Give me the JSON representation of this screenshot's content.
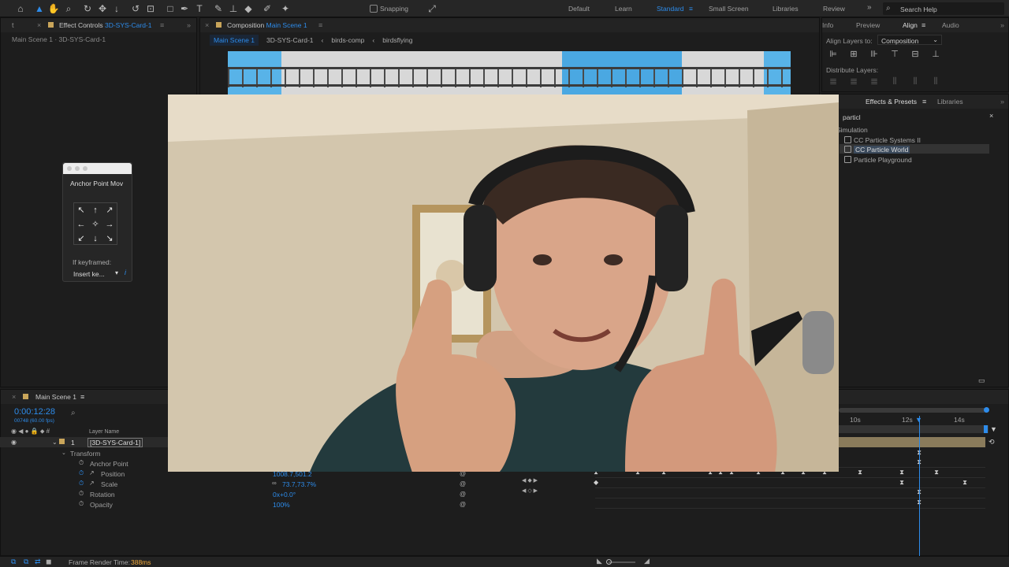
{
  "toolbar": {
    "snapping_label": "Snapping",
    "workspaces": [
      "Default",
      "Learn",
      "Standard",
      "Small Screen",
      "Libraries",
      "Review"
    ],
    "search_placeholder": "Search Help"
  },
  "effect_controls": {
    "tab_prefix": "Effect Controls",
    "tab_layer": "3D-SYS-Card-1",
    "subtitle": "Main Scene 1 · 3D-SYS-Card-1"
  },
  "composition": {
    "tab_prefix": "Composition",
    "tab_name": "Main Scene 1",
    "breadcrumbs": [
      "Main Scene 1",
      "3D-SYS-Card-1",
      "birds-comp",
      "birdsflying"
    ]
  },
  "anchor_window": {
    "title": "Anchor Point Mov",
    "if_keyframed_label": "If keyframed:",
    "dropdown_value": "Insert ke..."
  },
  "align_panel": {
    "tabs": [
      "Info",
      "Preview",
      "Align",
      "Audio"
    ],
    "align_layers_label": "Align Layers to:",
    "align_target": "Composition",
    "distribute_label": "Distribute Layers:"
  },
  "effects_panel": {
    "tabs": [
      "Effects & Presets",
      "Libraries"
    ],
    "search_value": "particl",
    "category": "Simulation",
    "items": [
      "CC Particle Systems II",
      "CC Particle World",
      "Particle Playground"
    ],
    "selected_index": 1
  },
  "timeline": {
    "comp_tab": "Main Scene 1",
    "timecode": "0:00:12:28",
    "frame_info": "00748 (60.00 fps)",
    "layer_name_header": "Layer Name",
    "layer_number": "1",
    "layer_name": "[3D-SYS-Card-1]",
    "transform_label": "Transform",
    "properties": [
      {
        "name": "Anchor Point",
        "value": ""
      },
      {
        "name": "Position",
        "value": "1008.7,501.2"
      },
      {
        "name": "Scale",
        "value": "73.7,73.7%"
      },
      {
        "name": "Rotation",
        "value": "0x+0.0°"
      },
      {
        "name": "Opacity",
        "value": "100%"
      }
    ],
    "ruler_labels": [
      "10s",
      "12s",
      "14s"
    ]
  },
  "status": {
    "render_label": "Frame Render Time:",
    "render_value": "388ms"
  },
  "colors": {
    "accent": "#2d8ceb",
    "panel_bg": "#1d1d1d",
    "layer_bar": "#8a7b5b"
  }
}
